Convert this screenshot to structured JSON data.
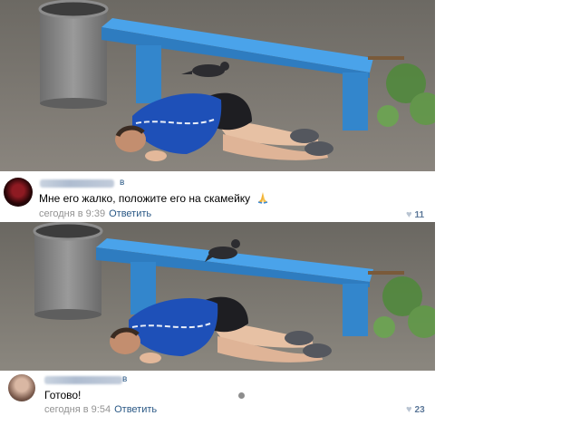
{
  "comments": [
    {
      "author_suffix": "в",
      "text": "Мне его жалко, положите его на скамейку",
      "emoji_name": "praying-hands-icon",
      "timestamp": "сегодня в 9:39",
      "reply_label": "Ответить",
      "likes": "11"
    },
    {
      "author_suffix": "в",
      "text": "Готово!",
      "timestamp": "сегодня в 9:54",
      "reply_label": "Ответить",
      "likes": "23"
    }
  ],
  "colors": {
    "link": "#2a5885",
    "meta": "#939393",
    "bench": "#3a8fd6",
    "ground": "#7e7a74"
  }
}
